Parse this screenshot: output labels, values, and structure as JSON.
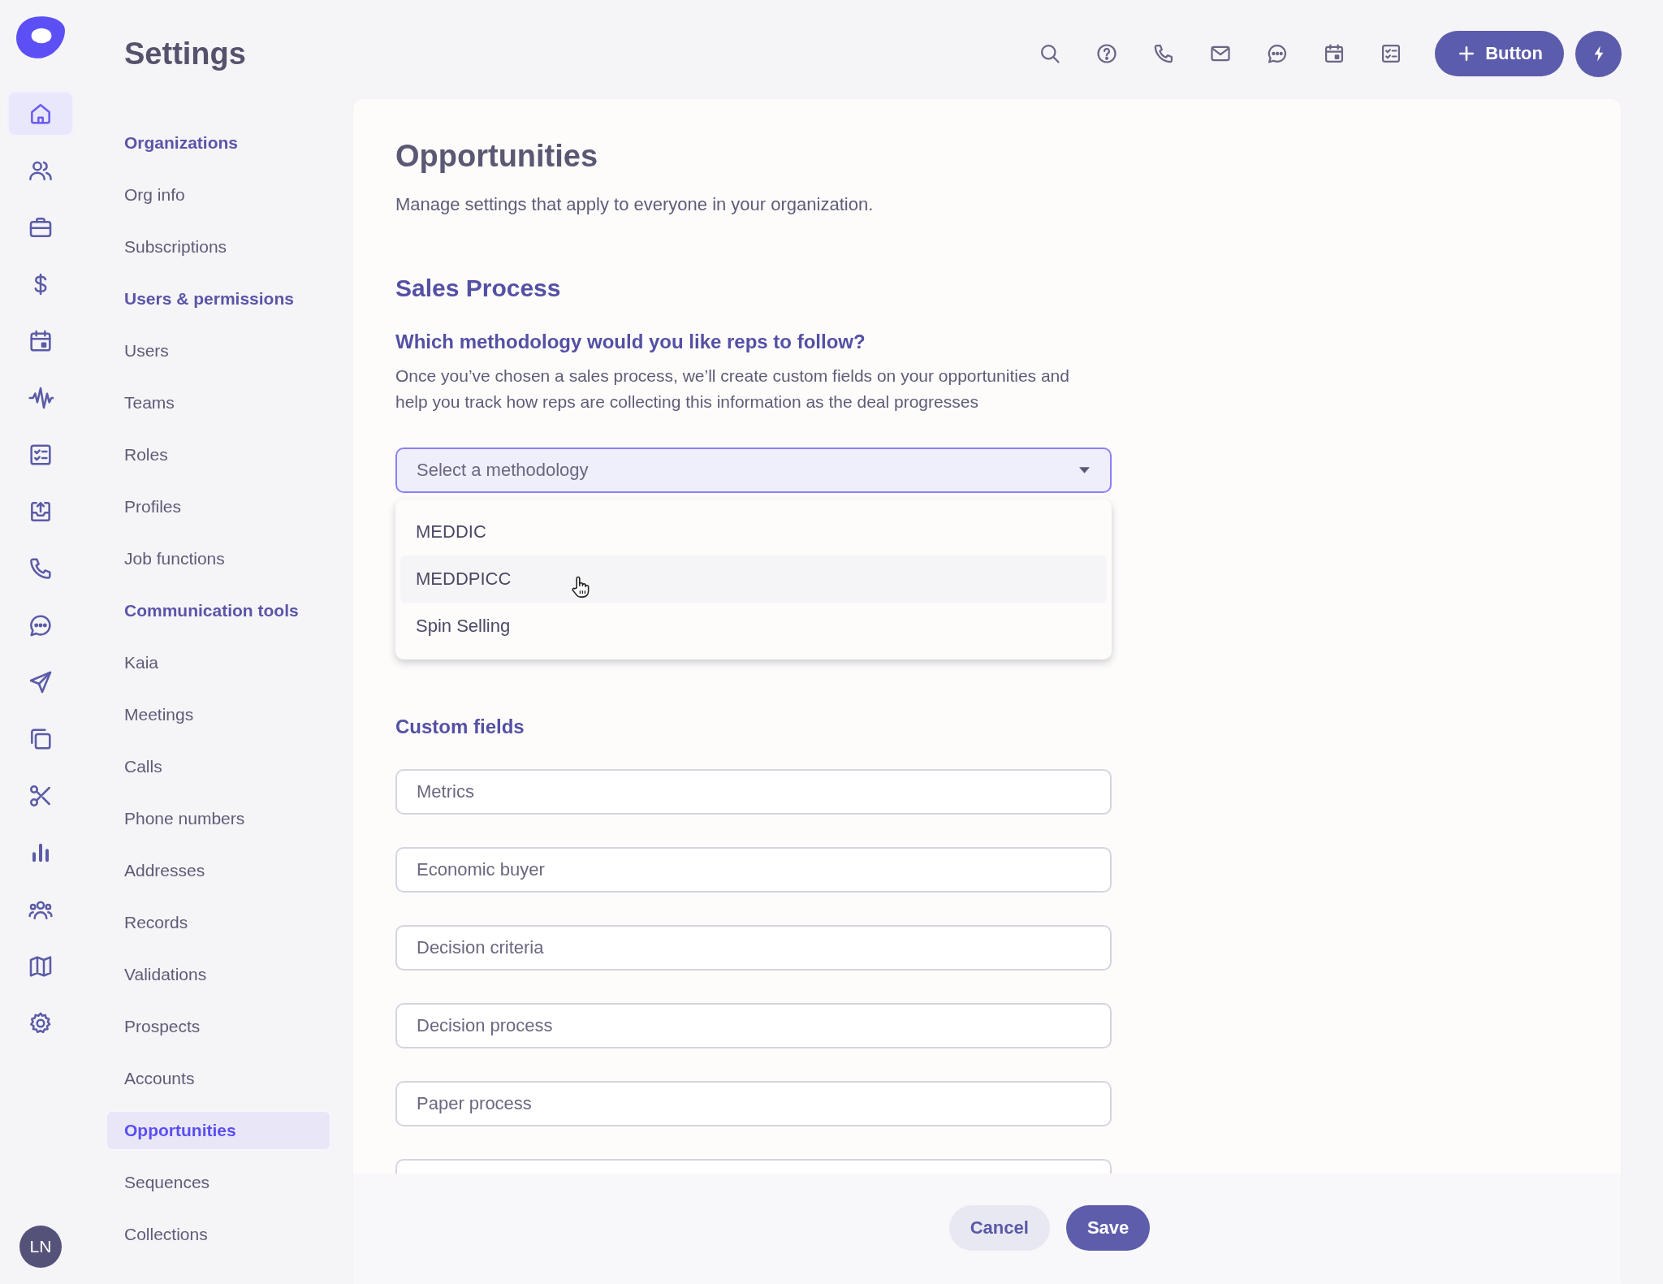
{
  "rail": {
    "items": [
      {
        "kind": "home",
        "selected": true
      },
      {
        "kind": "people",
        "selected": false
      },
      {
        "kind": "briefcase",
        "selected": false
      },
      {
        "kind": "dollar",
        "selected": false
      },
      {
        "kind": "calendar",
        "selected": false
      },
      {
        "kind": "wave",
        "selected": false
      },
      {
        "kind": "checklist",
        "selected": false
      },
      {
        "kind": "upload",
        "selected": false
      },
      {
        "kind": "phone",
        "selected": false
      },
      {
        "kind": "chat",
        "selected": false
      },
      {
        "kind": "send",
        "selected": false
      },
      {
        "kind": "copy",
        "selected": false
      },
      {
        "kind": "scissors",
        "selected": false
      },
      {
        "kind": "bars",
        "selected": false
      },
      {
        "kind": "group",
        "selected": false
      },
      {
        "kind": "map",
        "selected": false
      },
      {
        "kind": "gear",
        "selected": false
      }
    ],
    "avatar": {
      "initials": "LN"
    }
  },
  "header": {
    "title": "Settings",
    "tools": [
      {
        "kind": "search"
      },
      {
        "kind": "help"
      },
      {
        "kind": "phone"
      },
      {
        "kind": "mail"
      },
      {
        "kind": "chat"
      },
      {
        "kind": "calendar"
      },
      {
        "kind": "checklist"
      }
    ],
    "primary_button": {
      "label": "Button"
    }
  },
  "nav": {
    "items": [
      {
        "kind": "heading",
        "label": "Organizations"
      },
      {
        "kind": "link",
        "label": "Org info",
        "selected": false
      },
      {
        "kind": "link",
        "label": "Subscriptions",
        "selected": false
      },
      {
        "kind": "heading",
        "label": "Users & permissions"
      },
      {
        "kind": "link",
        "label": "Users",
        "selected": false
      },
      {
        "kind": "link",
        "label": "Teams",
        "selected": false
      },
      {
        "kind": "link",
        "label": "Roles",
        "selected": false
      },
      {
        "kind": "link",
        "label": "Profiles",
        "selected": false
      },
      {
        "kind": "link",
        "label": "Job functions",
        "selected": false
      },
      {
        "kind": "heading",
        "label": "Communication tools"
      },
      {
        "kind": "link",
        "label": "Kaia",
        "selected": false
      },
      {
        "kind": "link",
        "label": "Meetings",
        "selected": false
      },
      {
        "kind": "link",
        "label": "Calls",
        "selected": false
      },
      {
        "kind": "link",
        "label": "Phone numbers",
        "selected": false
      },
      {
        "kind": "link",
        "label": "Addresses",
        "selected": false
      },
      {
        "kind": "link",
        "label": "Records",
        "selected": false
      },
      {
        "kind": "link",
        "label": "Validations",
        "selected": false
      },
      {
        "kind": "link",
        "label": "Prospects",
        "selected": false
      },
      {
        "kind": "link",
        "label": "Accounts",
        "selected": false
      },
      {
        "kind": "link",
        "label": "Opportunities",
        "selected": true
      },
      {
        "kind": "link",
        "label": "Sequences",
        "selected": false
      },
      {
        "kind": "link",
        "label": "Collections",
        "selected": false
      }
    ]
  },
  "page": {
    "title": "Opportunities",
    "subtitle": "Manage settings that apply to everyone in your organization.",
    "section": "Sales Process",
    "question": "Which methodology would you like reps to follow?",
    "description": "Once you’ve chosen a sales process, we’ll create custom fields on your opportunities and help you track how reps are collecting this information as the deal progresses",
    "select": {
      "placeholder": "Select a methodology",
      "expanded": true,
      "options": [
        {
          "label": "MEDDIC",
          "hovered": false
        },
        {
          "label": "MEDDPICC",
          "hovered": true
        },
        {
          "label": "Spin Selling",
          "hovered": false
        }
      ]
    },
    "custom_fields_title": "Custom fields",
    "fields": [
      {
        "kind": "text",
        "placeholder": "Metrics"
      },
      {
        "kind": "text",
        "placeholder": "Economic buyer"
      },
      {
        "kind": "text",
        "placeholder": "Decision criteria"
      },
      {
        "kind": "text",
        "placeholder": "Decision process"
      },
      {
        "kind": "text",
        "placeholder": "Paper process"
      },
      {
        "kind": "partial"
      }
    ]
  },
  "footer": {
    "buttons": [
      {
        "kind": "secondary",
        "label": "Cancel"
      },
      {
        "kind": "primary",
        "label": "Save"
      }
    ]
  }
}
